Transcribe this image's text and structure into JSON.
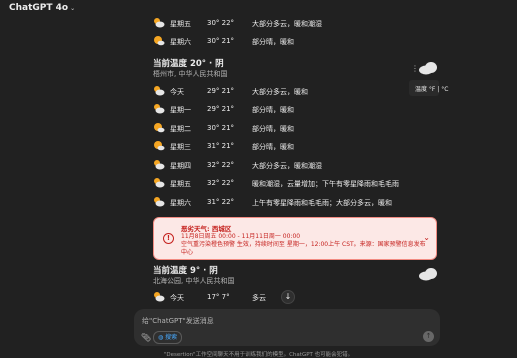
{
  "app": {
    "title": "ChatGPT 4o"
  },
  "forecast_top": [
    {
      "day": "星期五",
      "temp": "30° 22°",
      "desc": "大部分多云，暖和潮湿",
      "icon": "partly-cloudy"
    },
    {
      "day": "星期六",
      "temp": "30° 21°",
      "desc": "部分晴，暖和",
      "icon": "mostly-sunny"
    }
  ],
  "weather1": {
    "current": "当前温度 20° · 阴",
    "location": "梧州市, 中华人民共和国",
    "unit_toggle": "温度 °F | °C",
    "rows": [
      {
        "day": "今天",
        "temp": "29° 21°",
        "desc": "大部分多云，暖和",
        "icon": "partly-cloudy"
      },
      {
        "day": "星期一",
        "temp": "29° 21°",
        "desc": "部分晴，暖和",
        "icon": "partly-cloudy"
      },
      {
        "day": "星期二",
        "temp": "30° 21°",
        "desc": "部分晴，暖和",
        "icon": "mostly-sunny"
      },
      {
        "day": "星期三",
        "temp": "31° 21°",
        "desc": "部分晴，暖和",
        "icon": "mostly-sunny"
      },
      {
        "day": "星期四",
        "temp": "32° 22°",
        "desc": "大部分多云，暖和潮湿",
        "icon": "partly-cloudy"
      },
      {
        "day": "星期五",
        "temp": "32° 22°",
        "desc": "暖和潮湿，云量增加；下午有零星降雨和毛毛雨",
        "icon": "partly-cloudy"
      },
      {
        "day": "星期六",
        "temp": "31° 22°",
        "desc": "上午有零星降雨和毛毛雨；大部分多云，暖和",
        "icon": "partly-cloudy"
      }
    ]
  },
  "alert": {
    "title": "恶劣天气: 西城区",
    "line1": "11月8日周五 00:00 - 11月11日周一 00:00",
    "line2": "空气重污染橙色预警 生效，持续时间至 星期一，12:00上午 CST。来源：国家预警信息发布",
    "line3": "中心"
  },
  "weather2": {
    "current": "当前温度 9° · 阴",
    "location": "北海公园, 中华人民共和国",
    "row": {
      "day": "今天",
      "temp": "17° 7°",
      "desc": "多云",
      "icon": "partly-cloudy"
    }
  },
  "composer": {
    "placeholder": "给\"ChatGPT\"发送消息",
    "search_label": "搜索"
  },
  "footer": "\"Desertion\"工作空间聊天不用于训练我们的模型。ChatGPT 也可能会犯错。",
  "colors": {
    "background": "#212121",
    "alert_bg": "#fce8e6",
    "alert_text": "#c5221f",
    "sun": "#f5a623",
    "cloud": "#e6e6e6"
  }
}
